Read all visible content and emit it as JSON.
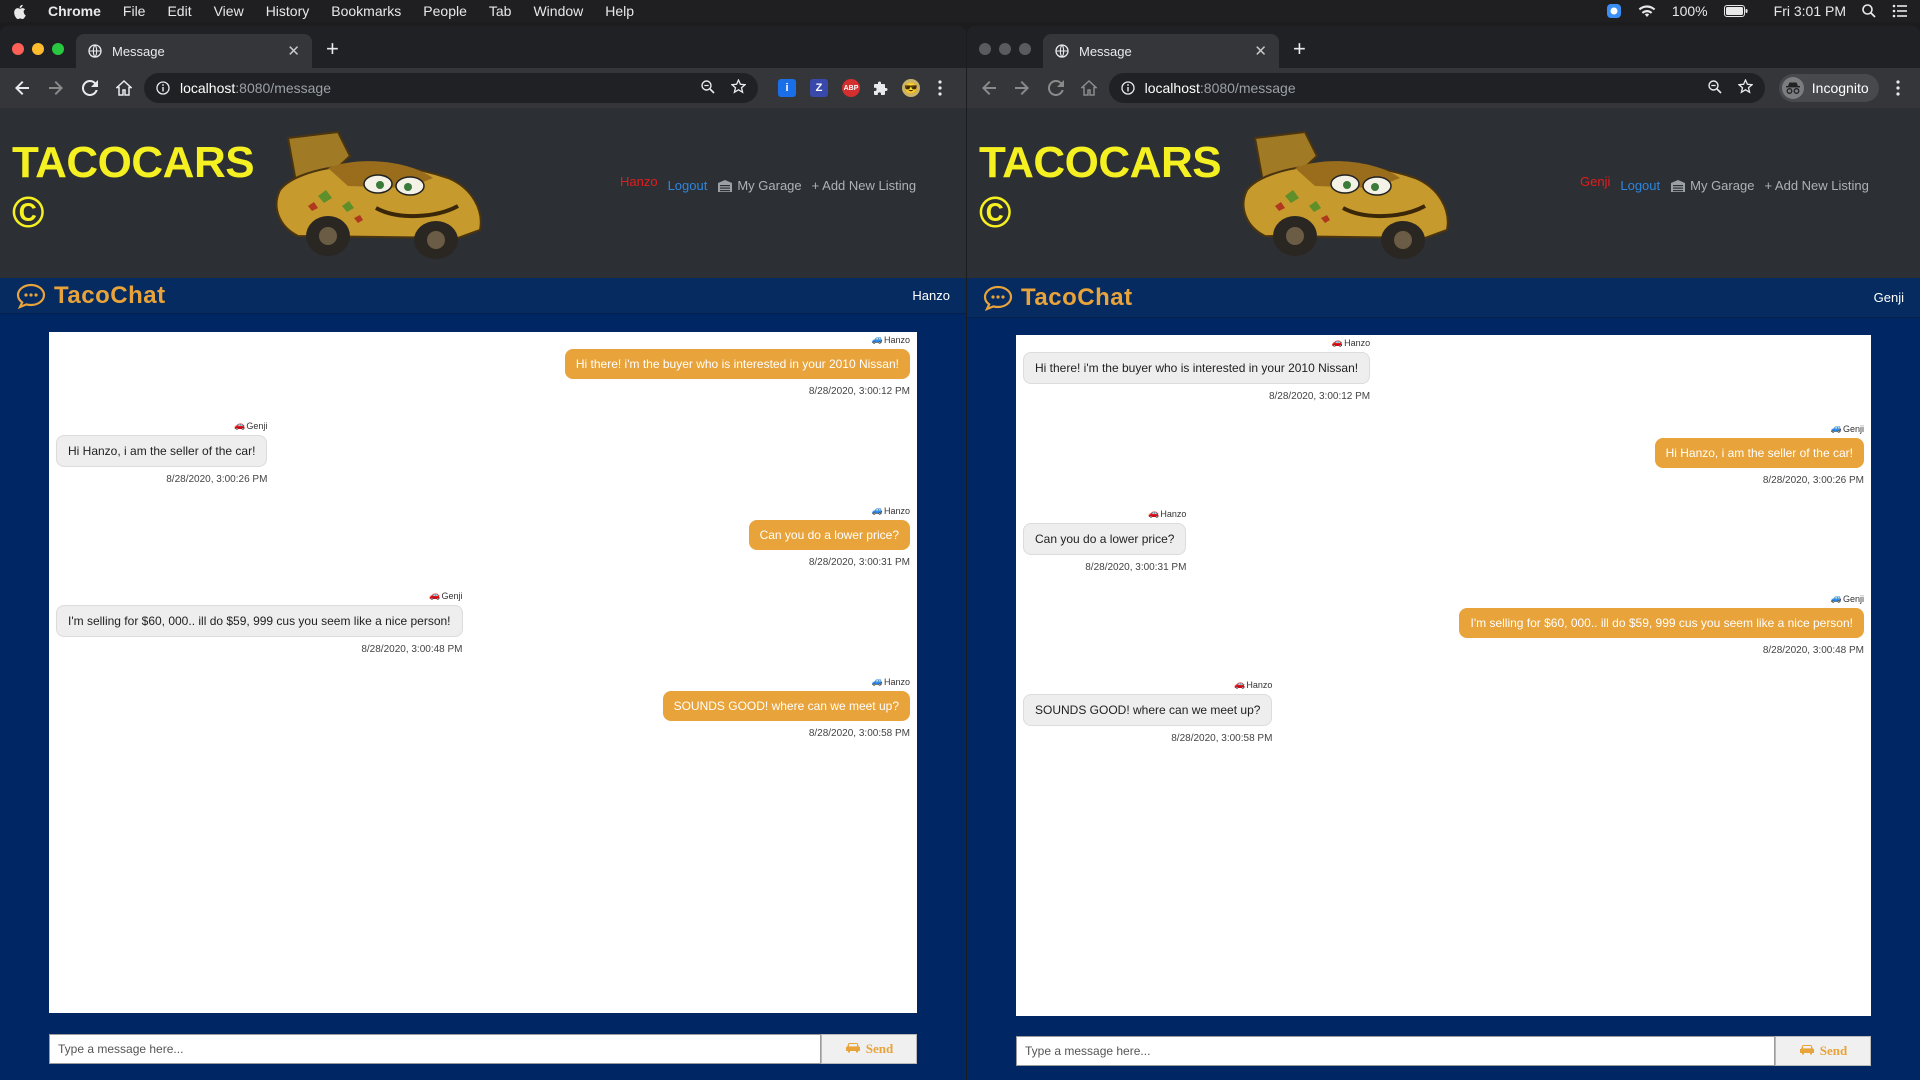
{
  "menubar": {
    "app": "Chrome",
    "items": [
      "File",
      "Edit",
      "View",
      "History",
      "Bookmarks",
      "People",
      "Tab",
      "Window",
      "Help"
    ],
    "battery": "100%",
    "clock": "Fri 3:01 PM"
  },
  "left_window": {
    "tab_title": "Message",
    "url_host": "localhost",
    "url_path": ":8080/message",
    "site": {
      "brand_line1": "TACOCARS",
      "brand_line2": "©",
      "nav_user": "Hanzo",
      "nav_logout": "Logout",
      "nav_garage": "My Garage",
      "nav_add": "+ Add New Listing"
    },
    "chat": {
      "title": "TacoChat",
      "current_user": "Hanzo",
      "messages": [
        {
          "sender": "Hanzo",
          "text": "Hi there! i'm the buyer who is interested in your 2010 Nissan!",
          "time": "8/28/2020, 3:00:12 PM"
        },
        {
          "sender": "Genji",
          "text": "Hi Hanzo, i am the seller of the car!",
          "time": "8/28/2020, 3:00:26 PM"
        },
        {
          "sender": "Hanzo",
          "text": "Can you do a lower price?",
          "time": "8/28/2020, 3:00:31 PM"
        },
        {
          "sender": "Genji",
          "text": "I'm selling for $60, 000.. ill do $59, 999 cus you seem like a nice person!",
          "time": "8/28/2020, 3:00:48 PM"
        },
        {
          "sender": "Hanzo",
          "text": "SOUNDS GOOD! where can we meet up?",
          "time": "8/28/2020, 3:00:58 PM"
        }
      ],
      "input_placeholder": "Type a message here...",
      "send_label": "Send"
    }
  },
  "right_window": {
    "tab_title": "Message",
    "url_host": "localhost",
    "url_path": ":8080/message",
    "incognito_label": "Incognito",
    "site": {
      "brand_line1": "TACOCARS",
      "brand_line2": "©",
      "nav_user": "Genji",
      "nav_logout": "Logout",
      "nav_garage": "My Garage",
      "nav_add": "+ Add New Listing"
    },
    "chat": {
      "title": "TacoChat",
      "current_user": "Genji",
      "messages": [
        {
          "sender": "Hanzo",
          "text": "Hi there! i'm the buyer who is interested in your 2010 Nissan!",
          "time": "8/28/2020, 3:00:12 PM"
        },
        {
          "sender": "Genji",
          "text": "Hi Hanzo, i am the seller of the car!",
          "time": "8/28/2020, 3:00:26 PM"
        },
        {
          "sender": "Hanzo",
          "text": "Can you do a lower price?",
          "time": "8/28/2020, 3:00:31 PM"
        },
        {
          "sender": "Genji",
          "text": "I'm selling for $60, 000.. ill do $59, 999 cus you seem like a nice person!",
          "time": "8/28/2020, 3:00:48 PM"
        },
        {
          "sender": "Hanzo",
          "text": "SOUNDS GOOD! where can we meet up?",
          "time": "8/28/2020, 3:00:58 PM"
        }
      ],
      "input_placeholder": "Type a message here...",
      "send_label": "Send"
    }
  },
  "colors": {
    "brand_yellow": "#f5f021",
    "chat_orange": "#e8a33a",
    "chat_navy": "#002663",
    "header_bg": "#2c2f33"
  },
  "icons": [
    "apple-icon",
    "wifi-icon",
    "battery-icon",
    "search-icon",
    "list-icon",
    "globe-icon",
    "back-icon",
    "forward-icon",
    "reload-icon",
    "home-icon",
    "info-icon",
    "zoom-icon",
    "star-icon",
    "extensions-icon",
    "menu-icon",
    "garage-icon",
    "chat-bubble-icon",
    "car-icon",
    "incognito-icon"
  ]
}
